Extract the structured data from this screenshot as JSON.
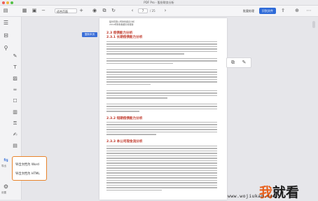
{
  "window": {
    "title": "PDF Pro - 股份财务分析"
  },
  "toolbar": {
    "zoom": "适合页面",
    "page_current": "7",
    "page_total": "/ 25",
    "btn_left": "批量处理",
    "btn_right": "识别文件",
    "colors": {
      "primary": "#2f6bd8"
    }
  },
  "sidebar": {
    "export_label": "导出",
    "settings_label": "设置"
  },
  "export_menu": {
    "items": [
      "导出文档为 Word",
      "导出文档为 HTML"
    ],
    "border_color": "#e8842c"
  },
  "document": {
    "header_line1": "股份有限公司财务报表分析",
    "header_line2": "2019年财务数据分析报告",
    "section1": "2.3  偿债能力分析",
    "section1_sub": "2.3.1 长期偿债能力分析",
    "section2": "2.3.2 短期偿债能力分析",
    "section3": "2.3.3 本公司现金流分析",
    "tag": "复制本页"
  },
  "watermark": {
    "text_a": "我",
    "text_b": "就看",
    "url": "www.wojiukan.com"
  }
}
